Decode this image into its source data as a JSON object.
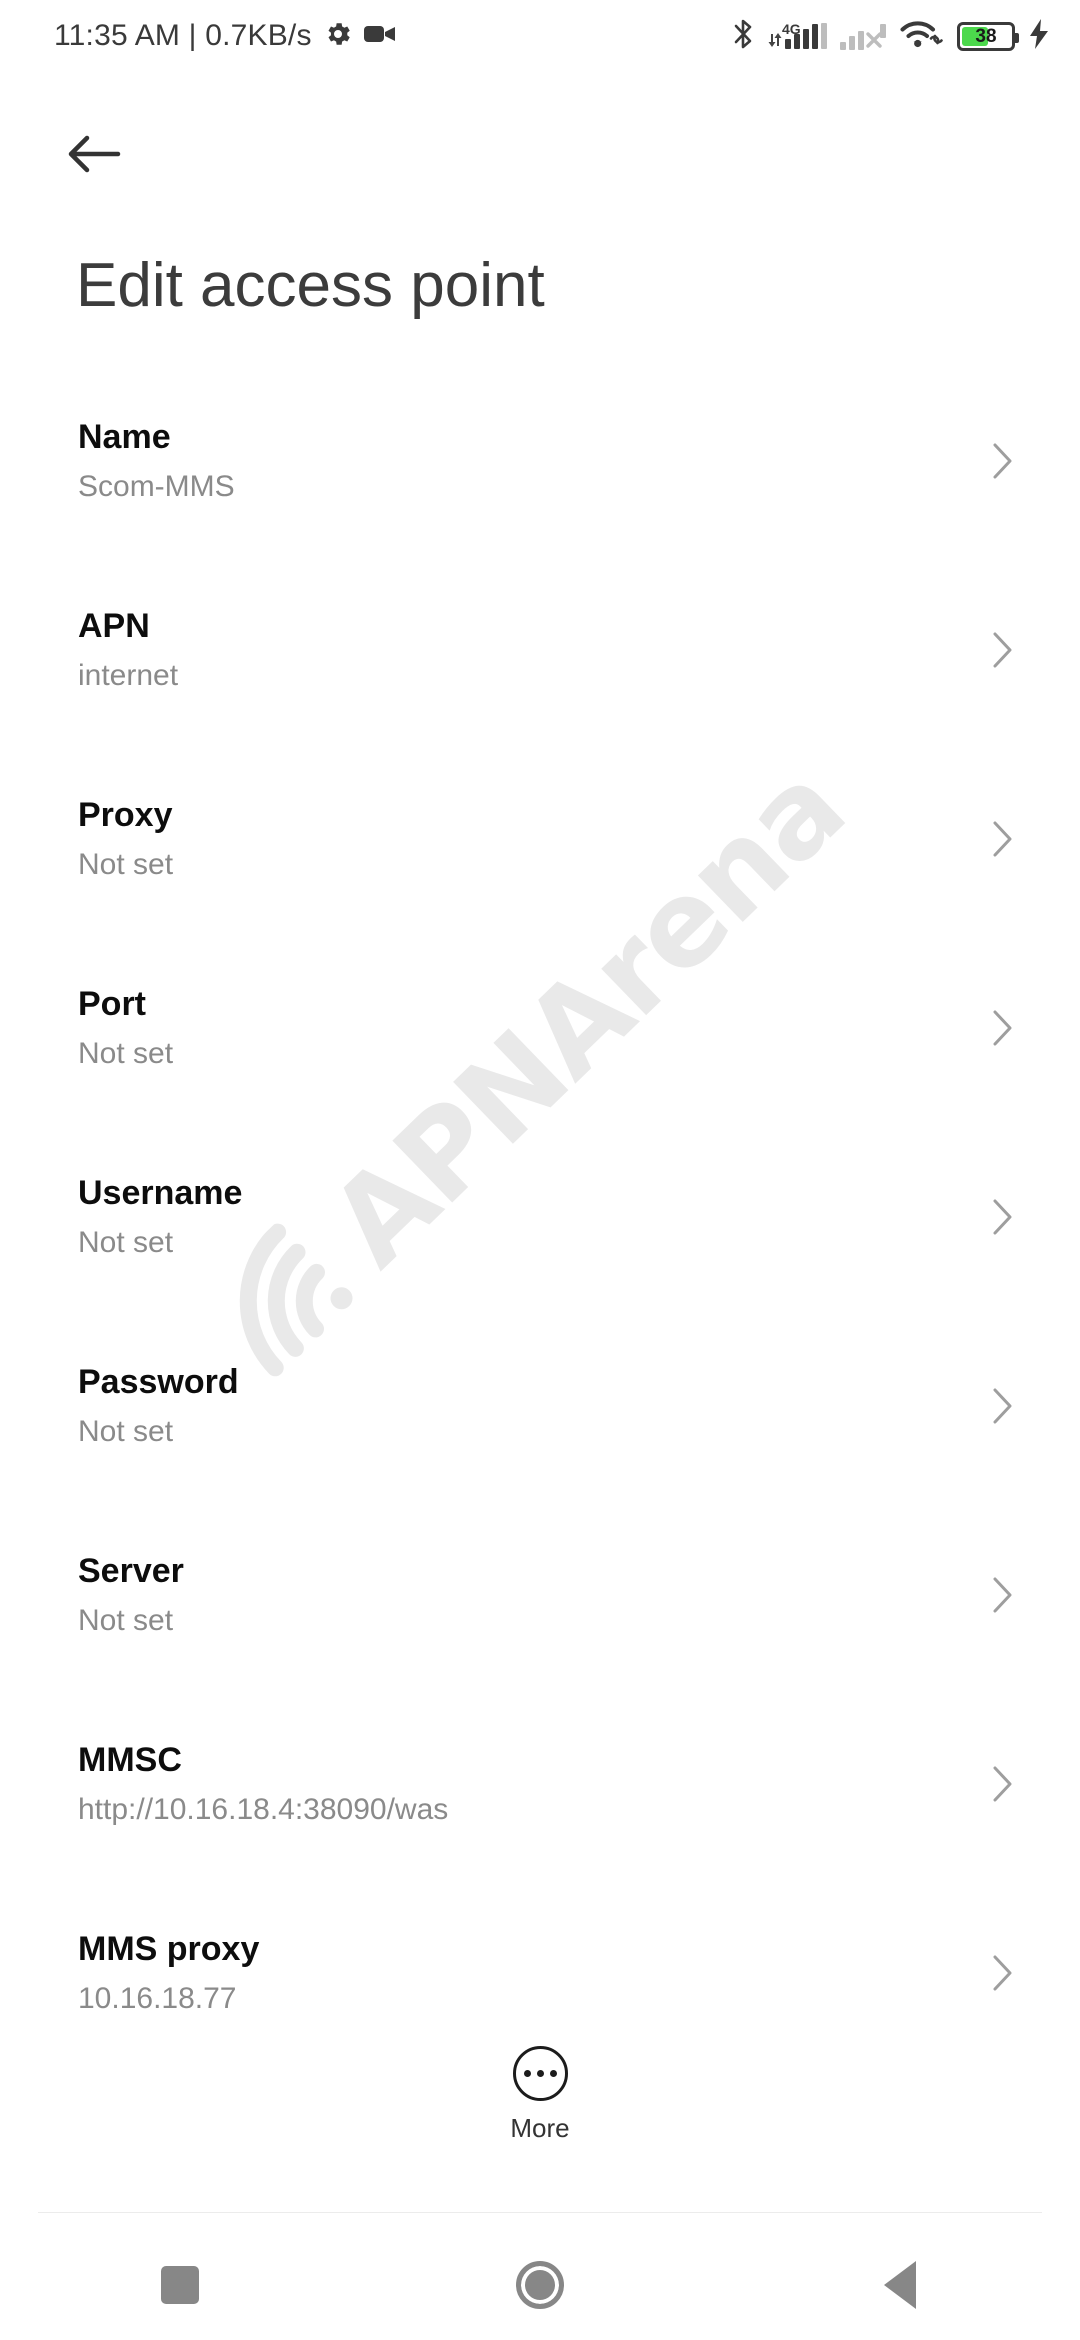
{
  "statusbar": {
    "clock": "11:35 AM | 0.7KB/s",
    "icons": {
      "settings": "gear-icon",
      "screen_record": "video-camera-icon",
      "bluetooth": "bluetooth-icon",
      "sim1": "signal-4g-icon",
      "sim2": "signal-no-service-icon",
      "wifi": "wifi-link-icon",
      "battery": "battery-icon",
      "charging": "charging-bolt-icon"
    },
    "network_type": "4G",
    "battery_level": "38"
  },
  "header": {
    "back": "back-arrow",
    "title": "Edit access point"
  },
  "watermark": {
    "text": "APNArena"
  },
  "list": [
    {
      "title": "Name",
      "value": "Scom-MMS"
    },
    {
      "title": "APN",
      "value": "internet"
    },
    {
      "title": "Proxy",
      "value": "Not set"
    },
    {
      "title": "Port",
      "value": "Not set"
    },
    {
      "title": "Username",
      "value": "Not set"
    },
    {
      "title": "Password",
      "value": "Not set"
    },
    {
      "title": "Server",
      "value": "Not set"
    },
    {
      "title": "MMSC",
      "value": "http://10.16.18.4:38090/was"
    },
    {
      "title": "MMS proxy",
      "value": "10.16.18.77"
    }
  ],
  "more": {
    "label": "More",
    "icon": "more-dots-circle-icon"
  },
  "navbar": {
    "recents": "recents-square-icon",
    "home": "home-circle-icon",
    "back": "back-triangle-icon"
  },
  "colors": {
    "background": "#ffffff",
    "title_text": "#3c3c3c",
    "row_title": "#0d0d0d",
    "row_value": "#8a8a8a",
    "chevron": "#9e9e9e",
    "watermark": "#e9e9e9",
    "battery_fill": "#4cd94c",
    "navbar_icon": "#878787"
  }
}
